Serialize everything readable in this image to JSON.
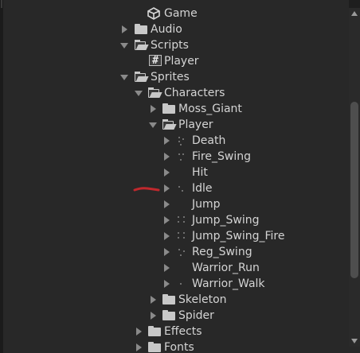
{
  "tree": [
    {
      "label": "Game",
      "icon": "unity-scene-icon",
      "arrow": "none",
      "indent": 0
    },
    {
      "label": "Audio",
      "icon": "folder-icon",
      "arrow": "collapsed",
      "indent": 0
    },
    {
      "label": "Scripts",
      "icon": "folder-open-icon",
      "arrow": "expanded",
      "indent": 0
    },
    {
      "label": "Player",
      "icon": "script-hash-icon",
      "arrow": "none",
      "indent": 1
    },
    {
      "label": "Sprites",
      "icon": "folder-open-icon",
      "arrow": "expanded",
      "indent": 0
    },
    {
      "label": "Characters",
      "icon": "folder-open-icon",
      "arrow": "expanded",
      "indent": 1
    },
    {
      "label": "Moss_Giant",
      "icon": "folder-icon",
      "arrow": "collapsed",
      "indent": 2
    },
    {
      "label": "Player",
      "icon": "folder-open-icon",
      "arrow": "expanded",
      "indent": 2
    },
    {
      "label": "Death",
      "icon": "sprite-icon",
      "arrow": "collapsed",
      "indent": 3
    },
    {
      "label": "Fire_Swing",
      "icon": "sprite-icon",
      "arrow": "collapsed",
      "indent": 3
    },
    {
      "label": "Hit",
      "icon": "sprite-icon",
      "arrow": "collapsed",
      "indent": 3
    },
    {
      "label": "Idle",
      "icon": "sprite-icon",
      "arrow": "collapsed",
      "indent": 3
    },
    {
      "label": "Jump",
      "icon": "sprite-icon",
      "arrow": "collapsed",
      "indent": 3
    },
    {
      "label": "Jump_Swing",
      "icon": "sprite-icon",
      "arrow": "collapsed",
      "indent": 3
    },
    {
      "label": "Jump_Swing_Fire",
      "icon": "sprite-icon",
      "arrow": "collapsed",
      "indent": 3
    },
    {
      "label": "Reg_Swing",
      "icon": "sprite-icon",
      "arrow": "collapsed",
      "indent": 3
    },
    {
      "label": "Warrior_Run",
      "icon": "sprite-icon",
      "arrow": "collapsed",
      "indent": 3
    },
    {
      "label": "Warrior_Walk",
      "icon": "sprite-icon",
      "arrow": "collapsed",
      "indent": 3
    },
    {
      "label": "Skeleton",
      "icon": "folder-icon",
      "arrow": "collapsed",
      "indent": 2
    },
    {
      "label": "Spider",
      "icon": "folder-icon",
      "arrow": "collapsed",
      "indent": 2
    },
    {
      "label": "Effects",
      "icon": "folder-icon",
      "arrow": "collapsed",
      "indent": 1
    },
    {
      "label": "Fonts",
      "icon": "folder-icon",
      "arrow": "collapsed",
      "indent": 1
    }
  ],
  "colors": {
    "background": "#282828",
    "text": "#d4d4d4",
    "annotation": "#c0282d"
  }
}
